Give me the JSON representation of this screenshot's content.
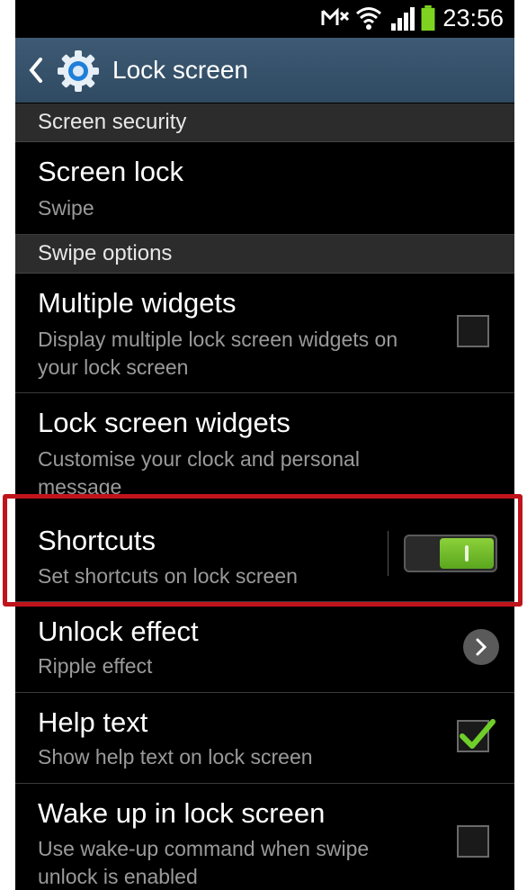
{
  "status_bar": {
    "time": "23:56",
    "icons": [
      "mute-icon",
      "wifi-icon",
      "signal-icon",
      "battery-icon"
    ],
    "battery_color": "#7ed321"
  },
  "action_bar": {
    "title": "Lock screen",
    "back_icon": "chevron-left-icon",
    "app_icon": "settings-gear-icon"
  },
  "sections": {
    "screen_security": "Screen security",
    "swipe_options": "Swipe options"
  },
  "items": {
    "screen_lock": {
      "title": "Screen lock",
      "subtitle": "Swipe"
    },
    "multiple_widgets": {
      "title": "Multiple widgets",
      "subtitle": "Display multiple lock screen widgets on your lock screen",
      "checked": false
    },
    "lock_screen_widgets": {
      "title": "Lock screen widgets",
      "subtitle": "Customise your clock and personal message"
    },
    "shortcuts": {
      "title": "Shortcuts",
      "subtitle": "Set shortcuts on lock screen",
      "toggle_on": true
    },
    "unlock_effect": {
      "title": "Unlock effect",
      "subtitle": "Ripple effect"
    },
    "help_text": {
      "title": "Help text",
      "subtitle": "Show help text on lock screen",
      "checked": true
    },
    "wake_up": {
      "title": "Wake up in lock screen",
      "subtitle": "Use wake-up command when swipe unlock is enabled",
      "checked": false
    }
  },
  "highlight_color": "#c0141c"
}
